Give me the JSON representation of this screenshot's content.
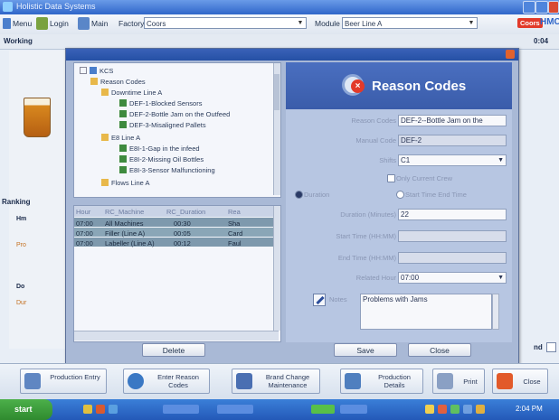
{
  "window": {
    "title": "Holistic Data Systems"
  },
  "toolbar": {
    "menu_label": "Menu",
    "login_label": "Login",
    "main_label": "Main",
    "factory_label": "Factory",
    "factory_value": "Coors",
    "module_label": "Module",
    "module_value": "Beer Line A",
    "brand_badge": "Coors",
    "right_text": "HMC"
  },
  "subbar": {
    "left_text": "Working",
    "right_text": "0:04"
  },
  "background_left": {
    "items": [
      "Ranking",
      "Hm",
      "Pro",
      "Do",
      "Dur"
    ]
  },
  "tree": {
    "nodes": [
      {
        "label": "KCS",
        "level": 0
      },
      {
        "label": "Reason Codes",
        "level": 1
      },
      {
        "label": "Downtime Line A",
        "level": 2
      },
      {
        "label": "DEF-1-Blocked Sensors",
        "level": 3
      },
      {
        "label": "DEF-2-Bottle Jam on the Outfeed",
        "level": 3
      },
      {
        "label": "DEF-3-Misaligned Pallets",
        "level": 3
      },
      {
        "label": "E8 Line A",
        "level": 2
      },
      {
        "label": "E8I-1-Gap in the infeed",
        "level": 3
      },
      {
        "label": "E8I-2-Missing Oil Bottles",
        "level": 3
      },
      {
        "label": "E8I-3-Sensor Malfunctioning",
        "level": 3
      },
      {
        "label": "Flows Line A",
        "level": 2
      }
    ]
  },
  "grid": {
    "headers": [
      "Hour",
      "RC_Machine",
      "RC_Duration",
      "Rea"
    ],
    "rows": [
      [
        "07:00",
        "All Machines",
        "00:30",
        "Sha"
      ],
      [
        "07:00",
        "Filler (Line A)",
        "00:05",
        "Card"
      ],
      [
        "07:00",
        "Labeller (Line A)",
        "00:12",
        "Faul"
      ]
    ]
  },
  "left_buttons": {
    "delete": "Delete"
  },
  "panel": {
    "title": "Reason Codes",
    "reason_code_label": "Reason Codes",
    "reason_code_value": "DEF-2--Bottle Jam on the",
    "manual_code_label": "Manual Code",
    "manual_code_value": "DEF-2",
    "shifts_label": "Shifts",
    "shifts_value": "C1",
    "only_current_label": "Only Current Crew",
    "duration_label": "Duration",
    "start_end_label": "Start Time End Time",
    "duration_minutes_label": "Duration (Minutes)",
    "duration_minutes_value": "22",
    "start_time_label": "Start Time (HH:MM)",
    "end_time_label": "End Time (HH:MM)",
    "related_hour_label": "Related Hour",
    "related_hour_value": "07:00",
    "notes_label": "Notes",
    "notes_value": "Problems with Jams",
    "save_label": "Save",
    "close_label": "Close"
  },
  "bottom": {
    "production_entry": "Production Entry",
    "enter_reason_codes": "Enter Reason Codes",
    "brand_change": "Brand Change Maintenance",
    "production_details": "Production Details",
    "print": "Print",
    "close": "Close",
    "side_label": "nd"
  },
  "taskbar": {
    "start": "start",
    "clock": "2:04 PM"
  },
  "colors": {
    "accent": "#2f66c9",
    "dialog": "#a9b9d6",
    "selected_row": "#7e99ad",
    "error_icon": "#e23a2a"
  }
}
